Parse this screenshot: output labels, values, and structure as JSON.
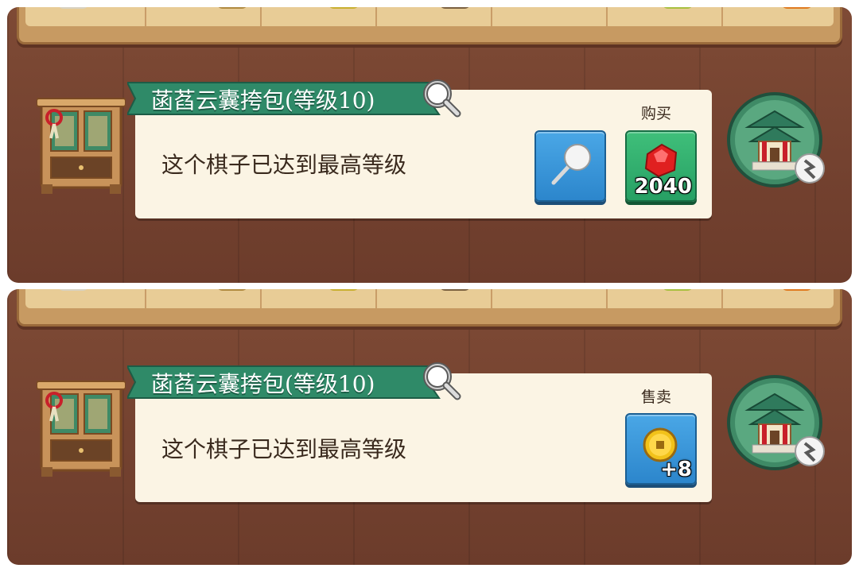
{
  "screens": [
    {
      "item_title": "菡萏云囊挎包(等级10)",
      "description": "这个棋子已达到最高等级",
      "action_label": "购买",
      "buttons": [
        {
          "name": "pin-button",
          "icon": "pin-icon"
        },
        {
          "name": "buy-gem-button",
          "icon": "red-gem-icon",
          "value": "2040"
        }
      ]
    },
    {
      "item_title": "菡萏云囊挎包(等级10)",
      "description": "这个棋子已达到最高等级",
      "action_label": "售卖",
      "buttons": [
        {
          "name": "sell-coin-button",
          "icon": "gold-coin-icon",
          "value": "+8"
        }
      ]
    }
  ],
  "colors": {
    "wood": "#744230",
    "card": "#fbf4e4",
    "ribbon": "#2f8a68",
    "button_blue": "#2c86cc",
    "button_green": "#27a064"
  }
}
